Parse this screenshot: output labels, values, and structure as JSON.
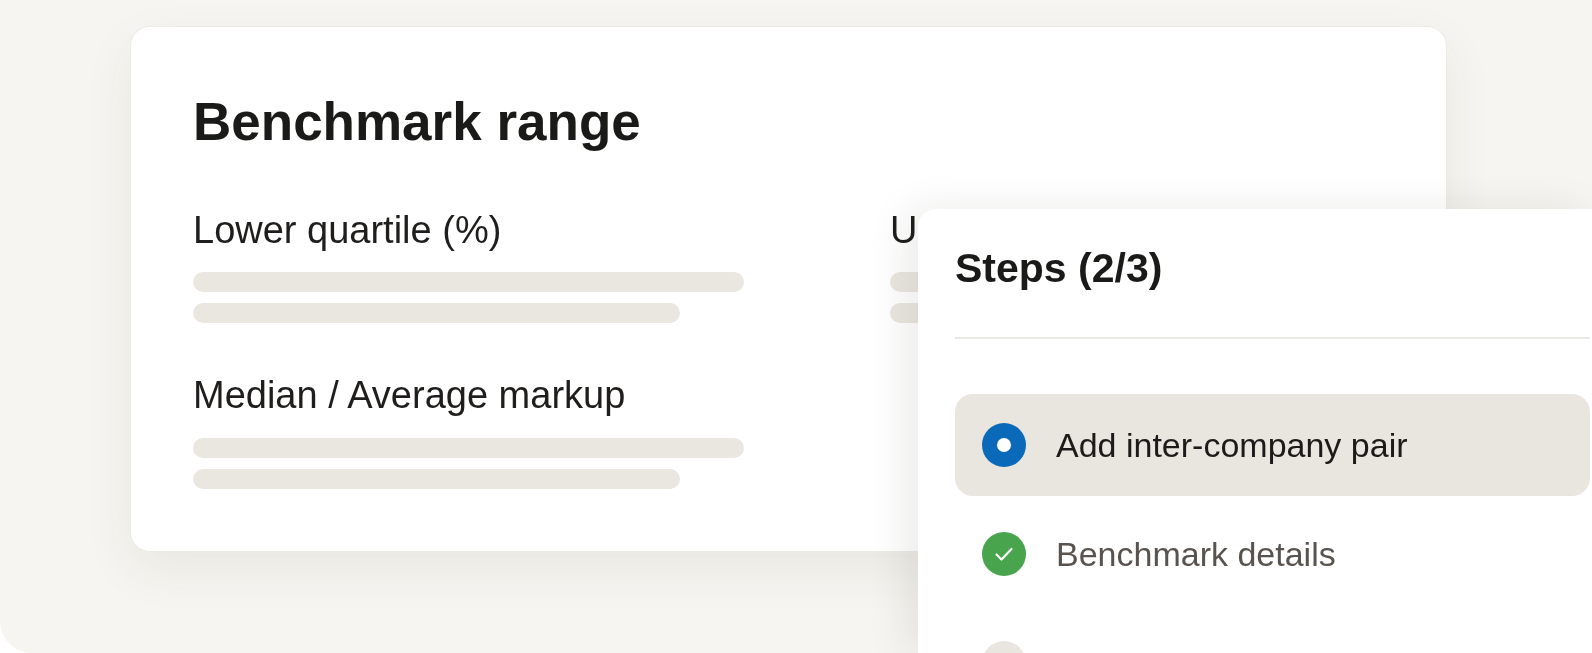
{
  "benchmark_card": {
    "title": "Benchmark range",
    "fields": [
      {
        "label": "Lower quartile (%)"
      },
      {
        "label": "U"
      },
      {
        "label": "Median / Average markup"
      }
    ]
  },
  "steps_panel": {
    "title": "Steps (2/3)",
    "items": [
      {
        "label": "Add inter-company pair",
        "kind": "current",
        "selected": true
      },
      {
        "label": "Benchmark details",
        "kind": "done",
        "selected": false
      },
      {
        "kind": "pending",
        "selected": false
      }
    ]
  }
}
